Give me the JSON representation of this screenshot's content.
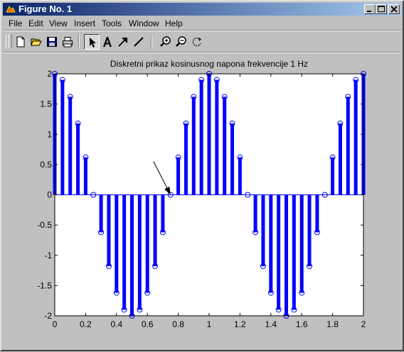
{
  "window": {
    "title": "Figure No. 1",
    "controls": [
      "minimize",
      "maximize",
      "close"
    ]
  },
  "menu": {
    "items": [
      "File",
      "Edit",
      "View",
      "Insert",
      "Tools",
      "Window",
      "Help"
    ]
  },
  "toolbar": {
    "tools": [
      "new-figure-icon",
      "open-file-icon",
      "save-icon",
      "print-icon",
      "select-arrow-icon",
      "insert-text-icon",
      "insert-arrow-icon",
      "insert-line-icon",
      "zoom-in-icon",
      "zoom-out-icon",
      "rotate-3d-icon"
    ],
    "pressed": "select-arrow-icon"
  },
  "colors": {
    "stem": "#0000ff",
    "background": "#c0c0c0",
    "axes": "#ffffff",
    "title_bar": "#0a246a",
    "arrow": "#000000"
  },
  "chart_data": {
    "type": "stem",
    "title": "Diskretni prikaz kosinusnog napona frekvencije 1 Hz",
    "xlabel": "",
    "ylabel": "",
    "xlim": [
      0,
      2
    ],
    "ylim": [
      -2,
      2
    ],
    "xticks": [
      "0",
      "0.2",
      "0.4",
      "0.6",
      "0.8",
      "1",
      "1.2",
      "1.4",
      "1.6",
      "1.8",
      "2"
    ],
    "yticks": [
      "-2",
      "-1.5",
      "-1",
      "-0.5",
      "0",
      "0.5",
      "1",
      "1.5",
      "2"
    ],
    "grid": false,
    "x": [
      0,
      0.05,
      0.1,
      0.15,
      0.2,
      0.25,
      0.3,
      0.35,
      0.4,
      0.45,
      0.5,
      0.55,
      0.6,
      0.65,
      0.7,
      0.75,
      0.8,
      0.85,
      0.9,
      0.95,
      1,
      1.05,
      1.1,
      1.15,
      1.2,
      1.25,
      1.3,
      1.35,
      1.4,
      1.45,
      1.5,
      1.55,
      1.6,
      1.65,
      1.7,
      1.75,
      1.8,
      1.85,
      1.9,
      1.95,
      2
    ],
    "y": [
      2,
      1.9,
      1.62,
      1.18,
      0.62,
      0,
      -0.62,
      -1.18,
      -1.62,
      -1.9,
      -2,
      -1.9,
      -1.62,
      -1.18,
      -0.62,
      0,
      0.62,
      1.18,
      1.62,
      1.9,
      2,
      1.9,
      1.62,
      1.18,
      0.62,
      0,
      -0.62,
      -1.18,
      -1.62,
      -1.9,
      -2,
      -1.9,
      -1.62,
      -1.18,
      -0.62,
      0,
      0.62,
      1.18,
      1.62,
      1.9,
      2
    ],
    "annotation": {
      "type": "arrow",
      "from": [
        0.64,
        0.55
      ],
      "to": [
        0.75,
        0
      ]
    }
  }
}
